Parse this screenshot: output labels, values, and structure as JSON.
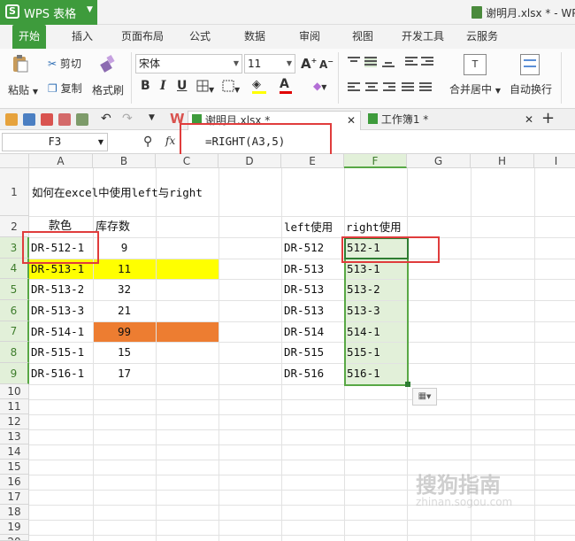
{
  "app": {
    "name": "WPS 表格",
    "logo_letter": "S",
    "doc_title": "谢明月.xlsx * - WP"
  },
  "ribbon_tabs": [
    "开始",
    "插入",
    "页面布局",
    "公式",
    "数据",
    "审阅",
    "视图",
    "开发工具",
    "云服务"
  ],
  "toolbar": {
    "cut": "剪切",
    "paste": "粘贴",
    "copy": "复制",
    "format_painter": "格式刷",
    "font_name": "宋体",
    "font_size": "11",
    "bold": "B",
    "italic": "I",
    "underline": "U",
    "grow_font": "A",
    "shrink_font": "A",
    "merge_center": "合并居中",
    "wrap_text": "自动换行"
  },
  "file_tabs": [
    {
      "name": "谢明月.xlsx *"
    },
    {
      "name": "工作簿1 *"
    }
  ],
  "formula_bar": {
    "cell_ref": "F3",
    "fx": "fx",
    "formula": "=RIGHT(A3,5)"
  },
  "columns": [
    "A",
    "B",
    "C",
    "D",
    "E",
    "F",
    "G",
    "H",
    "I"
  ],
  "selected_column": "F",
  "rows": [
    "1",
    "2",
    "3",
    "4",
    "5",
    "6",
    "7",
    "8",
    "9",
    "10",
    "11",
    "12",
    "13",
    "14",
    "15",
    "16",
    "17",
    "18",
    "19",
    "20"
  ],
  "selected_rows": [
    "3",
    "4",
    "5",
    "6",
    "7",
    "8",
    "9"
  ],
  "sheet": {
    "title": "如何在excel中使用left与right",
    "header_a": "款色",
    "header_b": "库存数",
    "header_e": "left使用",
    "header_f": "right使用",
    "col_a": [
      "DR-512-1",
      "DR-513-1",
      "DR-513-2",
      "DR-513-3",
      "DR-514-1",
      "DR-515-1",
      "DR-516-1"
    ],
    "col_b": [
      "9",
      "11",
      "32",
      "21",
      "99",
      "15",
      "17"
    ],
    "col_e": [
      "DR-512",
      "DR-513",
      "DR-513",
      "DR-513",
      "DR-514",
      "DR-515",
      "DR-516"
    ],
    "col_f": [
      "512-1",
      "513-1",
      "513-2",
      "513-3",
      "514-1",
      "515-1",
      "516-1"
    ]
  },
  "colors": {
    "accent": "#3e9b3c",
    "yellow_fill": "#ffff00",
    "orange_fill": "#ed7d31",
    "selection_fill": "#e2f0d9",
    "highlight_box": "#e03c3c"
  },
  "watermark": {
    "main": "搜狗指南",
    "sub": "zhinan.sogou.com"
  }
}
